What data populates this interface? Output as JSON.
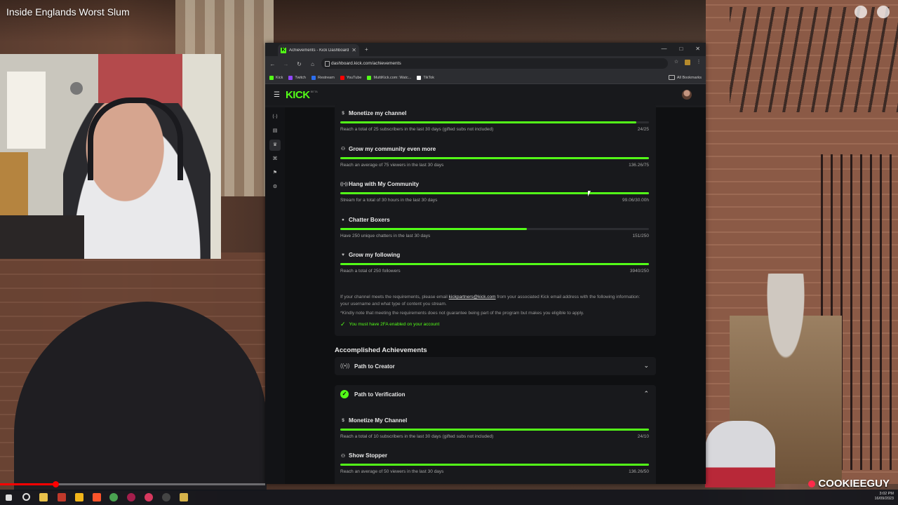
{
  "video": {
    "title": "Inside Englands Worst Slum",
    "progress_fraction": 0.21
  },
  "browser": {
    "tab_title": "Achievements - Kick Dashboard",
    "url": "dashboard.kick.com/achievements",
    "bookmarks": [
      {
        "label": "Kick",
        "color": "#53fc18"
      },
      {
        "label": "Twitch",
        "color": "#9146ff"
      },
      {
        "label": "Restream",
        "color": "#2c6ff0"
      },
      {
        "label": "YouTube",
        "color": "#ff0000"
      },
      {
        "label": "MultiKick.com: Watc...",
        "color": "#53fc18"
      },
      {
        "label": "TikTok",
        "color": "#ffffff"
      }
    ],
    "all_bookmarks": "All Bookmarks"
  },
  "kick": {
    "logo": "KICK",
    "beta": "BETA",
    "accent_color": "#53fc18",
    "requirements": [
      {
        "title": "Monetize my channel",
        "icon": "dollar-icon",
        "desc": "Reach a total of 25 subscribers in the last 30 days (gifted subs not included)",
        "value": "24/25",
        "progress": 0.96
      },
      {
        "title": "Grow my community even more",
        "icon": "people-icon",
        "desc": "Reach an average of 75 viewers in the last 30 days",
        "value": "136.26/75",
        "progress": 1.0
      },
      {
        "title": "Hang with My Community",
        "icon": "broadcast-icon",
        "desc": "Stream for a total of 30 hours in the last 30 days",
        "value": "99.06/30.00h",
        "progress": 1.0
      },
      {
        "title": "Chatter Boxers",
        "icon": "chat-icon",
        "desc": "Have 250 unique chatters in the last 30 days",
        "value": "151/250",
        "progress": 0.604
      },
      {
        "title": "Grow my following",
        "icon": "heart-icon",
        "desc": "Reach a total of 250 followers",
        "value": "3940/250",
        "progress": 1.0
      }
    ],
    "info": {
      "line1_pre": "If your channel meets the requirements, please email ",
      "email": "kickpartners@kick.com",
      "line1_post": " from your associated Kick email address with the following information: your username and what type of content you stream.",
      "note": "*Kindly note that meeting the requirements does not guarantee being part of the program but makes you eligible to apply.",
      "twofa": "You must have 2FA enabled on your account"
    },
    "accomplished_title": "Accomplished Achievements",
    "accomplished": [
      {
        "label": "Path to Creator",
        "expanded": false
      },
      {
        "label": "Path to Verification",
        "expanded": true
      }
    ],
    "verification_items": [
      {
        "title": "Monetize My Channel",
        "icon": "dollar-icon",
        "desc": "Reach a total of 10 subscribers in the last 30 days (gifted subs not included)",
        "value": "24/10",
        "progress": 1.0
      },
      {
        "title": "Show Stopper",
        "icon": "people-icon",
        "desc": "Reach an average of 50 viewers in the last 30 days",
        "value": "136.26/50",
        "progress": 1.0
      }
    ]
  },
  "taskbar": {
    "time": "3:02 PM",
    "date": "16/09/2023"
  },
  "watermark": "COOKIEEGUY"
}
